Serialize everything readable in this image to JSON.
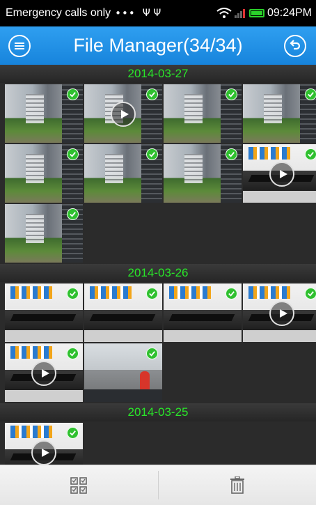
{
  "status_bar": {
    "carrier": "Emergency calls only",
    "dots": "•••",
    "usb_icons": "Ψ  Ψ",
    "time": "09:24PM"
  },
  "title_bar": {
    "title": "File Manager(34/34)"
  },
  "sections": [
    {
      "date": "2014-03-27"
    },
    {
      "date": "2014-03-26"
    },
    {
      "date": "2014-03-25"
    }
  ],
  "colors": {
    "accent_blue": "#1f8fe6",
    "date_green": "#29e629",
    "check_green": "#2fc02f"
  },
  "bottom_bar": {
    "left_icon": "select-all-grid-icon",
    "right_icon": "trash-icon"
  }
}
